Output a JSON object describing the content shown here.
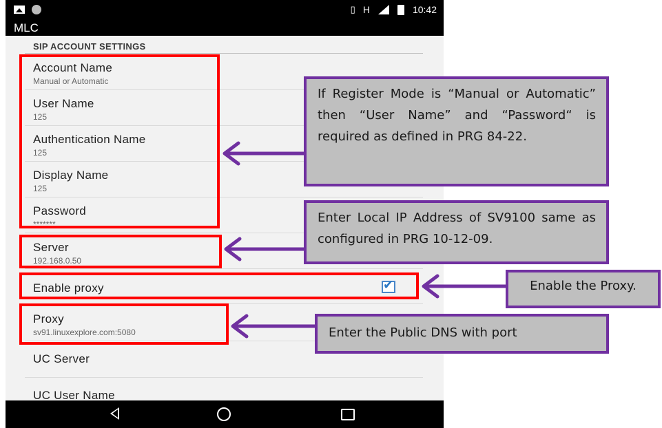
{
  "status_bar": {
    "network": "H",
    "time": "10:42"
  },
  "app_bar": {
    "title": "MLC"
  },
  "section_title": "SIP ACCOUNT SETTINGS",
  "settings": [
    {
      "title": "Account Name",
      "summary": "Manual or Automatic"
    },
    {
      "title": "User Name",
      "summary": "125"
    },
    {
      "title": "Authentication Name",
      "summary": "125"
    },
    {
      "title": "Display Name",
      "summary": "125"
    },
    {
      "title": "Password",
      "summary": "*******"
    },
    {
      "title": "Server",
      "summary": "192.168.0.50"
    },
    {
      "title": "Enable proxy",
      "checked": true
    },
    {
      "title": "Proxy",
      "summary": "sv91.linuxexplore.com:5080"
    },
    {
      "title": "UC Server"
    },
    {
      "title": "UC User Name"
    }
  ],
  "callouts": {
    "register_mode": "If Register Mode is “Manual or Automatic” then “User Name” and “Password“ is required as defined in PRG 84-22.",
    "server": "Enter Local IP Address of SV9100 same as configured in PRG 10-12-09.",
    "enable_proxy": "Enable the Proxy.",
    "proxy": "Enter the Public DNS with port"
  },
  "colors": {
    "highlight_box": "#ff0000",
    "callout_border": "#7030a0",
    "callout_fill": "#bfbfbf",
    "checkbox": "#2b78c5"
  }
}
